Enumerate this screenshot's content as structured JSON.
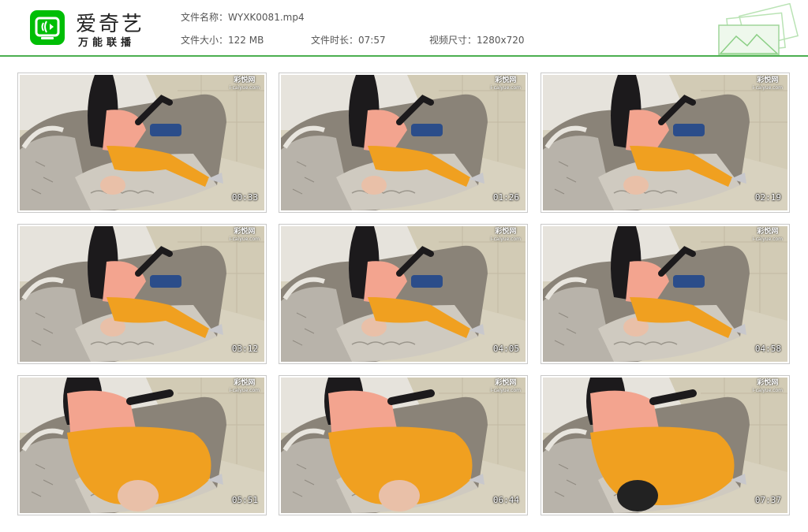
{
  "header": {
    "brand_name": "爱奇艺",
    "brand_sub": "万能联播",
    "file_name": "文件名称：WYXK0081.mp4",
    "file_size": "文件大小：122 MB",
    "duration": "文件时长：07:57",
    "dimensions": "视频尺寸：1280x720",
    "logo_icon": "iqiyi-tv-icon",
    "accent_color": "#00be06",
    "rule_color": "#4caf50"
  },
  "thumbnails": [
    {
      "timestamp": "00:33",
      "watermark": "彩悦网",
      "watermark_url": "i-caiyue.com"
    },
    {
      "timestamp": "01:26",
      "watermark": "彩悦网",
      "watermark_url": "i-caiyue.com"
    },
    {
      "timestamp": "02:19",
      "watermark": "彩悦网",
      "watermark_url": "i-caiyue.com"
    },
    {
      "timestamp": "03:12",
      "watermark": "彩悦网",
      "watermark_url": "i-caiyue.com"
    },
    {
      "timestamp": "04:05",
      "watermark": "彩悦网",
      "watermark_url": "i-caiyue.com"
    },
    {
      "timestamp": "04:58",
      "watermark": "彩悦网",
      "watermark_url": "i-caiyue.com"
    },
    {
      "timestamp": "05:51",
      "watermark": "彩悦网",
      "watermark_url": "i-caiyue.com"
    },
    {
      "timestamp": "06:44",
      "watermark": "彩悦网",
      "watermark_url": "i-caiyue.com"
    },
    {
      "timestamp": "07:37",
      "watermark": "彩悦网",
      "watermark_url": "i-caiyue.com"
    }
  ]
}
